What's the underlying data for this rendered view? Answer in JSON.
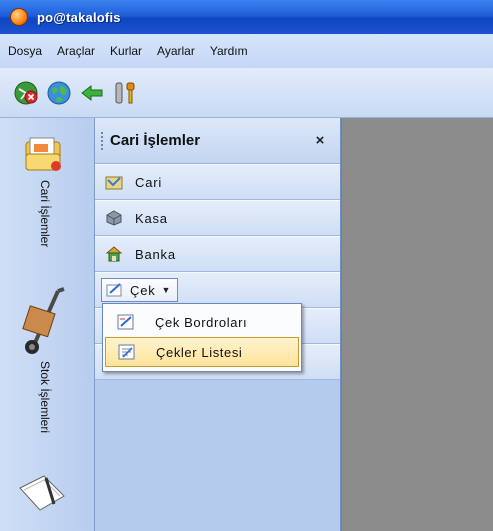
{
  "window": {
    "title": "po@takalofis"
  },
  "menu": {
    "items": [
      {
        "label": "Dosya"
      },
      {
        "label": "Araçlar"
      },
      {
        "label": "Kurlar"
      },
      {
        "label": "Ayarlar"
      },
      {
        "label": "Yardım"
      }
    ]
  },
  "toolbar": {
    "buttons": [
      {
        "icon": "disconnect-icon"
      },
      {
        "icon": "globe-icon"
      },
      {
        "icon": "back-arrow-icon"
      },
      {
        "icon": "tools-icon"
      }
    ]
  },
  "vstrip": {
    "tabs": [
      {
        "label": "Cari İşlemler",
        "icon": "cari-folder-icon"
      },
      {
        "label": "Stok İşlemleri",
        "icon": "hand-truck-icon"
      },
      {
        "label": "",
        "icon": "document-pen-icon"
      }
    ]
  },
  "panel": {
    "title": "Cari İşlemler",
    "close_glyph": "×",
    "items": [
      {
        "label": "Cari",
        "icon": "cari-icon"
      },
      {
        "label": "Kasa",
        "icon": "kasa-icon"
      },
      {
        "label": "Banka",
        "icon": "banka-icon"
      }
    ],
    "cek": {
      "label": "Çek",
      "arrow": "▼"
    }
  },
  "dropdown": {
    "items": [
      {
        "label": "Çek Bordroları",
        "highlighted": false
      },
      {
        "label": "Çekler Listesi",
        "highlighted": true
      }
    ]
  },
  "colors": {
    "titlebar": "#1f5fd8",
    "panel": "#c4d6f2",
    "workspace": "#8c8c8c",
    "highlight": "#ffe39a"
  }
}
